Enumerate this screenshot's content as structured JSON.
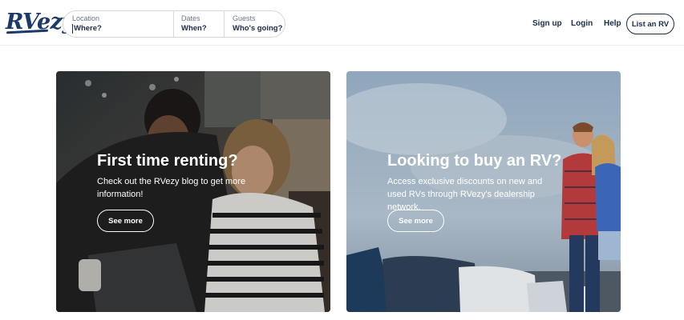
{
  "header": {
    "logo": "RVezy",
    "search": {
      "location_label": "Location",
      "location_placeholder": "Where?",
      "dates_label": "Dates",
      "dates_value": "When?",
      "guests_label": "Guests",
      "guests_value": "Who's going?"
    },
    "nav": {
      "signup": "Sign up",
      "login": "Login",
      "help": "Help",
      "list_rv": "List an RV"
    }
  },
  "cards": [
    {
      "title": "First time renting?",
      "text": "Check out the RVezy blog to get more information!",
      "button": "See more"
    },
    {
      "title": "Looking to buy an RV?",
      "text": "Access exclusive discounts on new and used RVs through RVezy's dealership network.",
      "button": "See more"
    }
  ],
  "colors": {
    "brand": "#1b3a6b",
    "text": "#1b2b4b",
    "border": "#d3d7de"
  }
}
